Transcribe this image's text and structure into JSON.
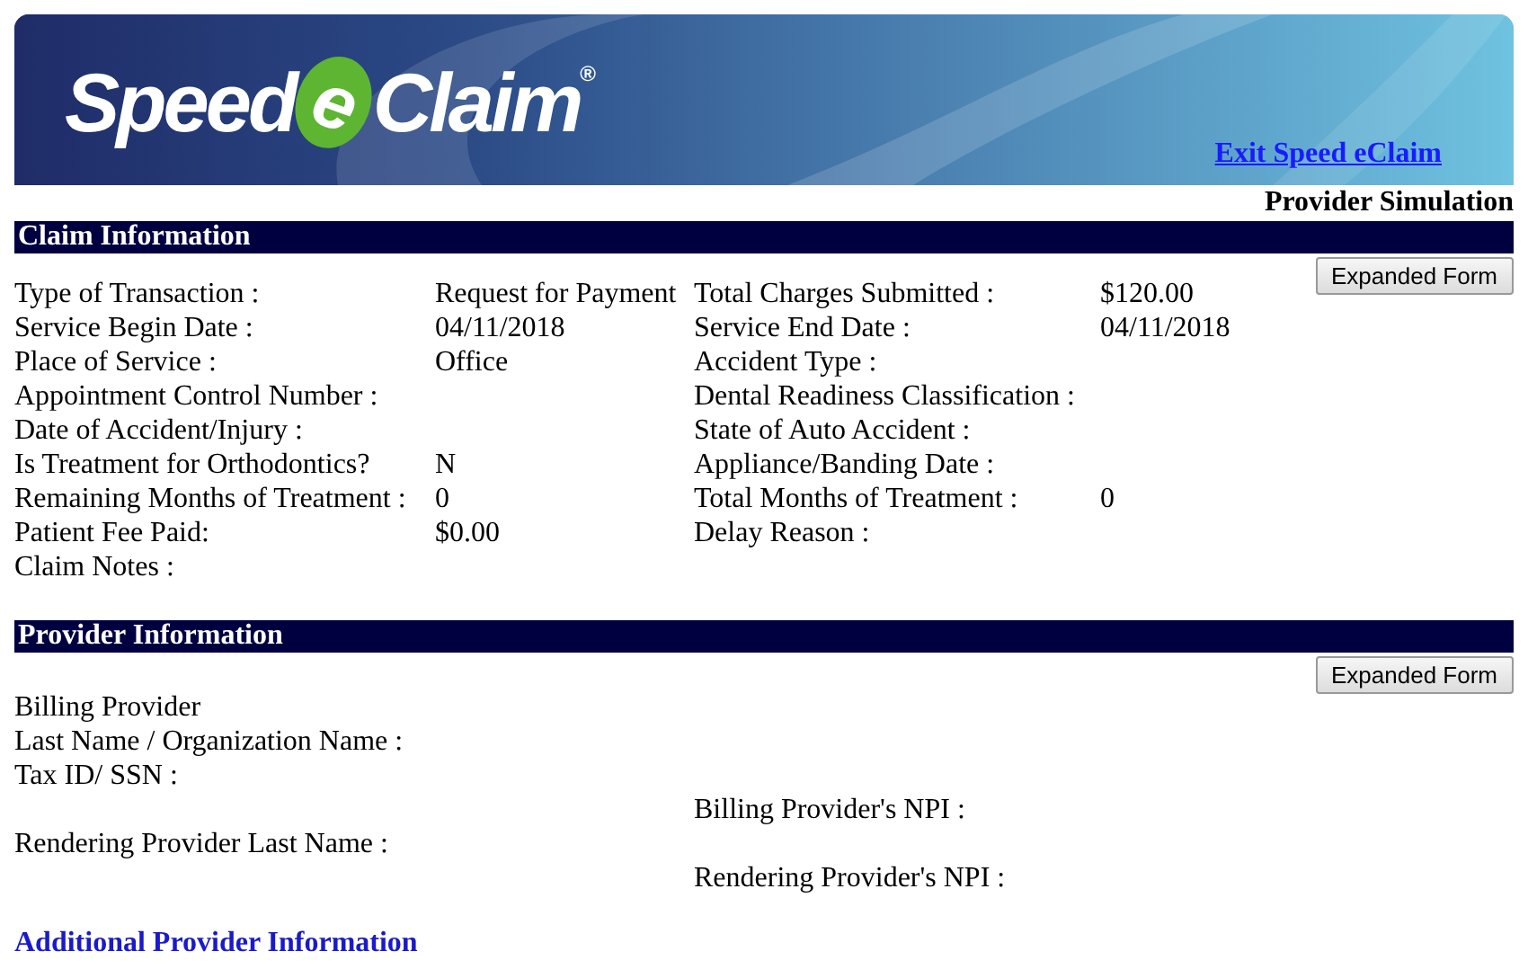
{
  "logo": {
    "before": "Speed",
    "mark": "e",
    "after": "Claim",
    "registered": "®"
  },
  "exit_link": "Exit Speed eClaim",
  "mode": "Provider Simulation",
  "claim_section": {
    "title": "Claim Information",
    "button": "Expanded Form",
    "rows": [
      {
        "label": "Type of Transaction :",
        "value": "Request for Payment",
        "label2": "Total Charges Submitted :",
        "value2": "$120.00"
      },
      {
        "label": "Service Begin Date :",
        "value": "04/11/2018",
        "label2": "Service End Date :",
        "value2": "04/11/2018"
      },
      {
        "label": "Place of Service :",
        "value": "Office",
        "label2": "Accident Type :"
      },
      {
        "label": "Appointment Control Number :",
        "label2": "Dental Readiness Classification :"
      },
      {
        "label": "Date of Accident/Injury :",
        "label2": "State of Auto Accident :"
      },
      {
        "label": "Is Treatment for Orthodontics?",
        "value": "N",
        "label2": "Appliance/Banding Date :"
      },
      {
        "label": "Remaining Months of Treatment :",
        "value": "0",
        "label2": "Total Months of Treatment :",
        "value2": "0"
      },
      {
        "label": "Patient Fee Paid:",
        "value": "$0.00",
        "label2": "Delay Reason :"
      },
      {
        "label": "Claim Notes :"
      }
    ]
  },
  "provider_section": {
    "title": "Provider Information",
    "button": "Expanded Form",
    "rows": [
      {
        "label": "Billing Provider"
      },
      {
        "label": "Last Name / Organization Name :"
      },
      {
        "label": "Tax ID/ SSN :"
      },
      {
        "label2": "Billing Provider's NPI :"
      },
      {
        "label": "Rendering Provider Last Name :"
      },
      {
        "label2": "Rendering Provider's NPI :"
      }
    ]
  },
  "additional_link": "Additional Provider Information"
}
